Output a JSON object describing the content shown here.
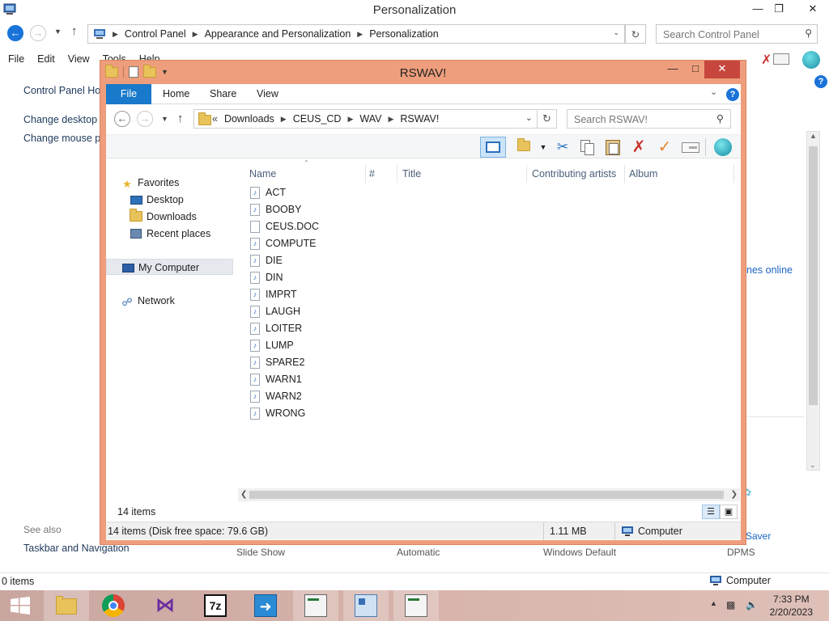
{
  "background_window": {
    "title": "Personalization",
    "breadcrumbs": [
      "Control Panel",
      "Appearance and Personalization",
      "Personalization"
    ],
    "search_placeholder": "Search Control Panel",
    "menu": [
      "File",
      "Edit",
      "View",
      "Tools",
      "Help"
    ],
    "left_links": [
      "Control Panel Hom",
      "Change desktop i",
      "Change mouse po"
    ],
    "see_also_label": "See also",
    "taskbar_link": "Taskbar and Navigation",
    "right_link": "nes online",
    "bottom_items": [
      "Slide Show",
      "Automatic",
      "Windows Default",
      "DPMS"
    ],
    "saver_label": "Saver",
    "status_items": "0 items",
    "status_computer": "Computer"
  },
  "explorer": {
    "title": "RSWAV!",
    "tabs": [
      "File",
      "Home",
      "Share",
      "View"
    ],
    "breadcrumbs": [
      "Downloads",
      "CEUS_CD",
      "WAV",
      "RSWAV!"
    ],
    "breadcrumb_overflow": "«",
    "search_placeholder": "Search RSWAV!",
    "nav": {
      "favorites": "Favorites",
      "desktop": "Desktop",
      "downloads": "Downloads",
      "recent": "Recent places",
      "computer": "My Computer",
      "network": "Network"
    },
    "columns": [
      "Name",
      "#",
      "Title",
      "Contributing artists",
      "Album"
    ],
    "files": [
      {
        "name": "ACT",
        "type": "audio"
      },
      {
        "name": "BOOBY",
        "type": "audio"
      },
      {
        "name": "CEUS.DOC",
        "type": "doc"
      },
      {
        "name": "COMPUTE",
        "type": "audio"
      },
      {
        "name": "DIE",
        "type": "audio"
      },
      {
        "name": "DIN",
        "type": "audio"
      },
      {
        "name": "IMPRT",
        "type": "audio"
      },
      {
        "name": "LAUGH",
        "type": "audio"
      },
      {
        "name": "LOITER",
        "type": "audio"
      },
      {
        "name": "LUMP",
        "type": "audio"
      },
      {
        "name": "SPARE2",
        "type": "audio"
      },
      {
        "name": "WARN1",
        "type": "audio"
      },
      {
        "name": "WARN2",
        "type": "audio"
      },
      {
        "name": "WRONG",
        "type": "audio"
      }
    ],
    "item_count": "14 items",
    "status_detail": "14 items (Disk free space: 79.6 GB)",
    "status_size": "1.11 MB",
    "status_location": "Computer"
  },
  "taskbar": {
    "apps": [
      "start",
      "file-explorer",
      "chrome",
      "visual-studio",
      "7zip",
      "remote-app",
      "notepad-app",
      "control-panel",
      "window-app"
    ],
    "time": "7:33 PM",
    "date": "2/20/2023"
  },
  "colors": {
    "explorer_frame": "#ee9e7c",
    "accent_blue": "#1979ca",
    "close_red": "#c7463d"
  }
}
